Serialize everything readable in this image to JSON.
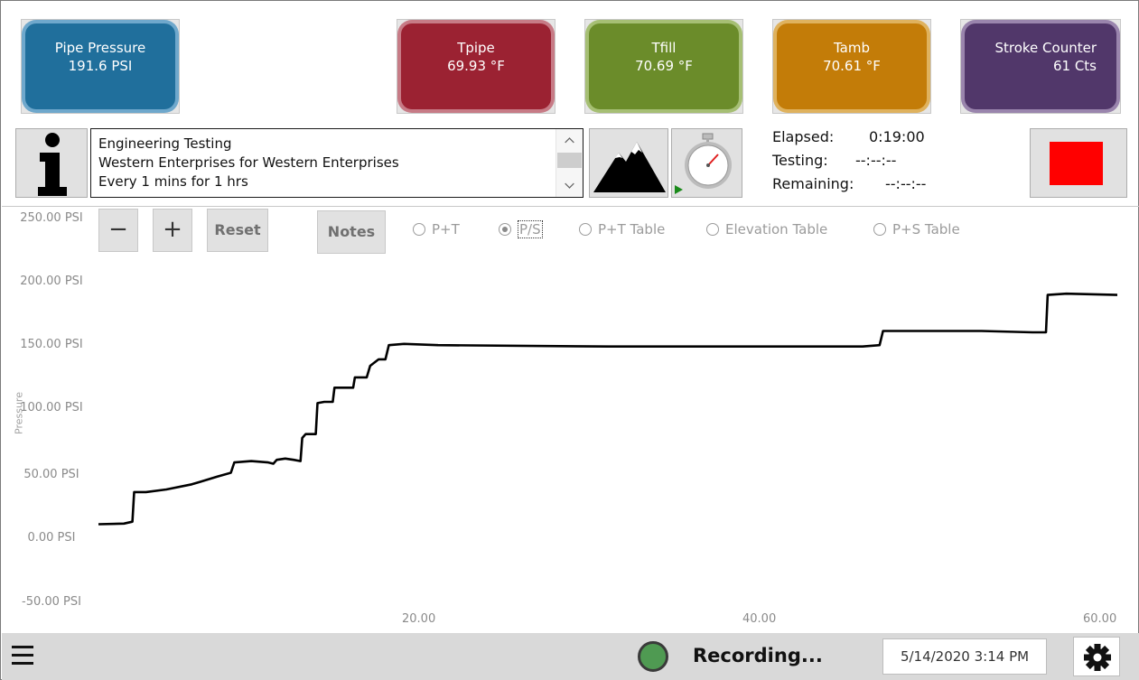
{
  "gauges": [
    {
      "label": "Pipe Pressure",
      "value": "191.6 PSI",
      "color": "#206f9c",
      "ring": "#6fa8cc"
    },
    {
      "label": "Tpipe",
      "value": "69.93 °F",
      "color": "#9b2232",
      "ring": "#c77b86"
    },
    {
      "label": "Tfill",
      "value": "70.69 °F",
      "color": "#6b8c2a",
      "ring": "#a6bf74"
    },
    {
      "label": "Tamb",
      "value": "70.61 °F",
      "color": "#c37c08",
      "ring": "#dfb25e"
    },
    {
      "label": "Stroke Counter",
      "value": "61 Cts",
      "color": "#51376a",
      "ring": "#9a85ad"
    }
  ],
  "info": {
    "lines": [
      "Engineering Testing",
      "Western Enterprises for Western Enterprises",
      "Every 1 mins for 1 hrs"
    ]
  },
  "timing": {
    "elapsed_label": "Elapsed:",
    "elapsed_value": "0:19:00",
    "testing_label": "Testing:",
    "testing_value": "--:--:--",
    "remaining_label": "Remaining:",
    "remaining_value": "--:--:--"
  },
  "controls": {
    "minus": "−",
    "plus": "+",
    "reset": "Reset",
    "notes": "Notes",
    "radios": [
      {
        "label": "P+T",
        "selected": false
      },
      {
        "label": "P/S",
        "selected": true
      },
      {
        "label": "P+T Table",
        "selected": false
      },
      {
        "label": "Elevation Table",
        "selected": false
      },
      {
        "label": "P+S Table",
        "selected": false
      }
    ]
  },
  "chart_data": {
    "type": "line",
    "ylabel": "Pressure",
    "ylim": [
      -50,
      250
    ],
    "xlim": [
      0,
      60
    ],
    "ytick_labels": [
      "250.00 PSI",
      "200.00 PSI",
      "150.00 PSI",
      "100.00 PSI",
      "50.00 PSI",
      "0.00 PSI",
      "-50.00 PSI"
    ],
    "yticks": [
      250,
      200,
      150,
      100,
      50,
      0,
      -50
    ],
    "xtick_labels": [
      "20.00",
      "40.00",
      "60.00"
    ],
    "xticks": [
      20,
      40,
      60
    ],
    "series": [
      {
        "color": "#000000",
        "points": [
          [
            0,
            12
          ],
          [
            1.5,
            12.5
          ],
          [
            2.0,
            14
          ],
          [
            2.1,
            37
          ],
          [
            2.8,
            37
          ],
          [
            4.0,
            39
          ],
          [
            5.5,
            43
          ],
          [
            6.0,
            45
          ],
          [
            7.0,
            49
          ],
          [
            7.8,
            52
          ],
          [
            8.0,
            60
          ],
          [
            9.0,
            61
          ],
          [
            10.0,
            60
          ],
          [
            10.3,
            59
          ],
          [
            10.5,
            62
          ],
          [
            11.0,
            63
          ],
          [
            11.5,
            62
          ],
          [
            11.9,
            61
          ],
          [
            12.0,
            79
          ],
          [
            12.2,
            82
          ],
          [
            12.6,
            82
          ],
          [
            12.8,
            82
          ],
          [
            12.9,
            106
          ],
          [
            13.3,
            107
          ],
          [
            13.8,
            107
          ],
          [
            13.9,
            118
          ],
          [
            14.4,
            118
          ],
          [
            15.0,
            118
          ],
          [
            15.1,
            126
          ],
          [
            15.8,
            126
          ],
          [
            16.0,
            135
          ],
          [
            16.5,
            140
          ],
          [
            16.9,
            140
          ],
          [
            17.1,
            151
          ],
          [
            18.0,
            152
          ],
          [
            20.0,
            151
          ],
          [
            30.0,
            150
          ],
          [
            40.0,
            150
          ],
          [
            45.0,
            150
          ],
          [
            46.0,
            151
          ],
          [
            46.2,
            162
          ],
          [
            48.0,
            162
          ],
          [
            52.0,
            162
          ],
          [
            55.0,
            161
          ],
          [
            55.8,
            161
          ],
          [
            55.9,
            190
          ],
          [
            57.0,
            191
          ],
          [
            60.0,
            190
          ]
        ]
      }
    ]
  },
  "status": {
    "recording": "Recording...",
    "datetime": "5/14/2020 3:14 PM",
    "led_color": "#4f9a52"
  },
  "icons": {
    "info": "info-icon",
    "mountain": "mountain-icon",
    "stopwatch": "stopwatch-icon",
    "stop": "stop-icon",
    "menu": "menu-icon",
    "gear": "gear-icon"
  }
}
